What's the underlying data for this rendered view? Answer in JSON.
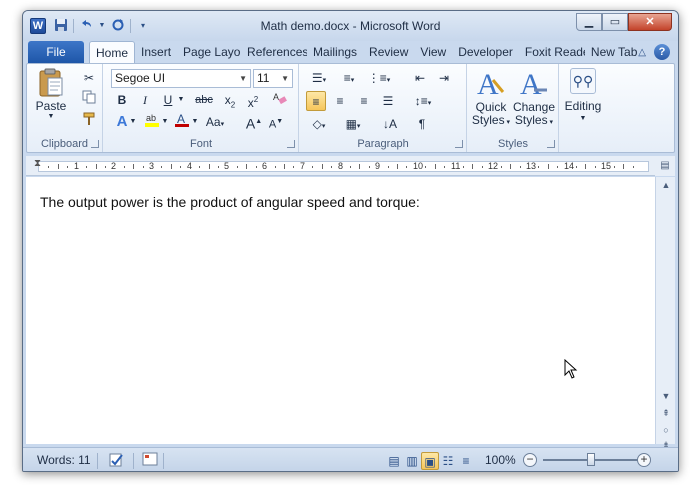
{
  "window": {
    "title": "Math demo.docx - Microsoft Word",
    "app_icon_letter": "W"
  },
  "quick_access": [
    "save-icon",
    "undo-icon",
    "redo-icon",
    "customize-icon"
  ],
  "tabs": {
    "file": "File",
    "items": [
      "Home",
      "Insert",
      "Page Layout",
      "References",
      "Mailings",
      "Review",
      "View",
      "Developer",
      "Foxit Reader PDF",
      "New Tab"
    ],
    "active": "Home"
  },
  "ribbon": {
    "clipboard": {
      "label": "Clipboard",
      "paste": "Paste"
    },
    "font": {
      "label": "Font",
      "font_name": "Segoe UI",
      "font_size": "11"
    },
    "paragraph": {
      "label": "Paragraph"
    },
    "styles": {
      "label": "Styles",
      "quick_styles": "Quick",
      "quick_styles2": "Styles",
      "change_styles": "Change",
      "change_styles2": "Styles"
    },
    "editing": {
      "label": "Editing"
    }
  },
  "ruler": {
    "numbers": [
      "1",
      "2",
      "3",
      "4",
      "5",
      "6",
      "7",
      "8",
      "9",
      "10",
      "11",
      "12",
      "13",
      "14",
      "15"
    ]
  },
  "document": {
    "text": "The output power is the product of angular speed and torque:"
  },
  "status": {
    "words": "Words: 11",
    "zoom": "100%",
    "zoom_fraction": 0.5
  }
}
